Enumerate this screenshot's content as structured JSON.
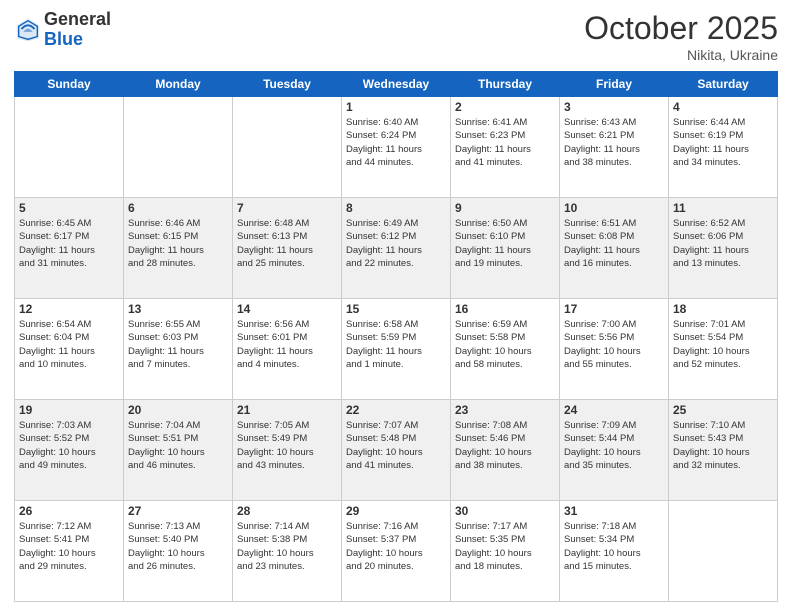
{
  "logo": {
    "general": "General",
    "blue": "Blue"
  },
  "header": {
    "month": "October 2025",
    "location": "Nikita, Ukraine"
  },
  "weekdays": [
    "Sunday",
    "Monday",
    "Tuesday",
    "Wednesday",
    "Thursday",
    "Friday",
    "Saturday"
  ],
  "weeks": [
    [
      {
        "day": "",
        "info": ""
      },
      {
        "day": "",
        "info": ""
      },
      {
        "day": "",
        "info": ""
      },
      {
        "day": "1",
        "info": "Sunrise: 6:40 AM\nSunset: 6:24 PM\nDaylight: 11 hours\nand 44 minutes."
      },
      {
        "day": "2",
        "info": "Sunrise: 6:41 AM\nSunset: 6:23 PM\nDaylight: 11 hours\nand 41 minutes."
      },
      {
        "day": "3",
        "info": "Sunrise: 6:43 AM\nSunset: 6:21 PM\nDaylight: 11 hours\nand 38 minutes."
      },
      {
        "day": "4",
        "info": "Sunrise: 6:44 AM\nSunset: 6:19 PM\nDaylight: 11 hours\nand 34 minutes."
      }
    ],
    [
      {
        "day": "5",
        "info": "Sunrise: 6:45 AM\nSunset: 6:17 PM\nDaylight: 11 hours\nand 31 minutes."
      },
      {
        "day": "6",
        "info": "Sunrise: 6:46 AM\nSunset: 6:15 PM\nDaylight: 11 hours\nand 28 minutes."
      },
      {
        "day": "7",
        "info": "Sunrise: 6:48 AM\nSunset: 6:13 PM\nDaylight: 11 hours\nand 25 minutes."
      },
      {
        "day": "8",
        "info": "Sunrise: 6:49 AM\nSunset: 6:12 PM\nDaylight: 11 hours\nand 22 minutes."
      },
      {
        "day": "9",
        "info": "Sunrise: 6:50 AM\nSunset: 6:10 PM\nDaylight: 11 hours\nand 19 minutes."
      },
      {
        "day": "10",
        "info": "Sunrise: 6:51 AM\nSunset: 6:08 PM\nDaylight: 11 hours\nand 16 minutes."
      },
      {
        "day": "11",
        "info": "Sunrise: 6:52 AM\nSunset: 6:06 PM\nDaylight: 11 hours\nand 13 minutes."
      }
    ],
    [
      {
        "day": "12",
        "info": "Sunrise: 6:54 AM\nSunset: 6:04 PM\nDaylight: 11 hours\nand 10 minutes."
      },
      {
        "day": "13",
        "info": "Sunrise: 6:55 AM\nSunset: 6:03 PM\nDaylight: 11 hours\nand 7 minutes."
      },
      {
        "day": "14",
        "info": "Sunrise: 6:56 AM\nSunset: 6:01 PM\nDaylight: 11 hours\nand 4 minutes."
      },
      {
        "day": "15",
        "info": "Sunrise: 6:58 AM\nSunset: 5:59 PM\nDaylight: 11 hours\nand 1 minute."
      },
      {
        "day": "16",
        "info": "Sunrise: 6:59 AM\nSunset: 5:58 PM\nDaylight: 10 hours\nand 58 minutes."
      },
      {
        "day": "17",
        "info": "Sunrise: 7:00 AM\nSunset: 5:56 PM\nDaylight: 10 hours\nand 55 minutes."
      },
      {
        "day": "18",
        "info": "Sunrise: 7:01 AM\nSunset: 5:54 PM\nDaylight: 10 hours\nand 52 minutes."
      }
    ],
    [
      {
        "day": "19",
        "info": "Sunrise: 7:03 AM\nSunset: 5:52 PM\nDaylight: 10 hours\nand 49 minutes."
      },
      {
        "day": "20",
        "info": "Sunrise: 7:04 AM\nSunset: 5:51 PM\nDaylight: 10 hours\nand 46 minutes."
      },
      {
        "day": "21",
        "info": "Sunrise: 7:05 AM\nSunset: 5:49 PM\nDaylight: 10 hours\nand 43 minutes."
      },
      {
        "day": "22",
        "info": "Sunrise: 7:07 AM\nSunset: 5:48 PM\nDaylight: 10 hours\nand 41 minutes."
      },
      {
        "day": "23",
        "info": "Sunrise: 7:08 AM\nSunset: 5:46 PM\nDaylight: 10 hours\nand 38 minutes."
      },
      {
        "day": "24",
        "info": "Sunrise: 7:09 AM\nSunset: 5:44 PM\nDaylight: 10 hours\nand 35 minutes."
      },
      {
        "day": "25",
        "info": "Sunrise: 7:10 AM\nSunset: 5:43 PM\nDaylight: 10 hours\nand 32 minutes."
      }
    ],
    [
      {
        "day": "26",
        "info": "Sunrise: 7:12 AM\nSunset: 5:41 PM\nDaylight: 10 hours\nand 29 minutes."
      },
      {
        "day": "27",
        "info": "Sunrise: 7:13 AM\nSunset: 5:40 PM\nDaylight: 10 hours\nand 26 minutes."
      },
      {
        "day": "28",
        "info": "Sunrise: 7:14 AM\nSunset: 5:38 PM\nDaylight: 10 hours\nand 23 minutes."
      },
      {
        "day": "29",
        "info": "Sunrise: 7:16 AM\nSunset: 5:37 PM\nDaylight: 10 hours\nand 20 minutes."
      },
      {
        "day": "30",
        "info": "Sunrise: 7:17 AM\nSunset: 5:35 PM\nDaylight: 10 hours\nand 18 minutes."
      },
      {
        "day": "31",
        "info": "Sunrise: 7:18 AM\nSunset: 5:34 PM\nDaylight: 10 hours\nand 15 minutes."
      },
      {
        "day": "",
        "info": ""
      }
    ]
  ]
}
